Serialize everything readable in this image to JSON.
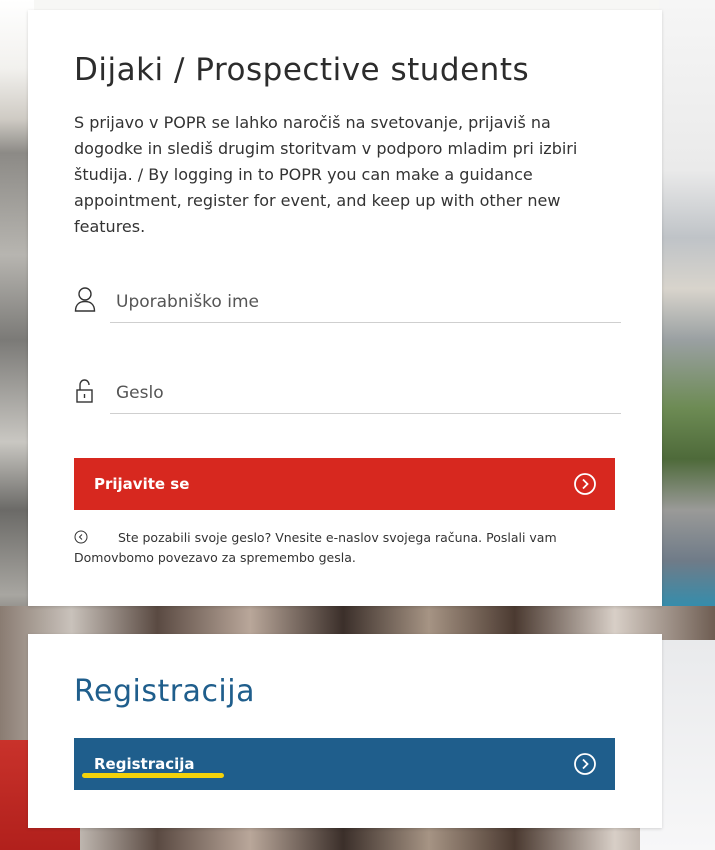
{
  "login": {
    "title": "Dijaki / Prospective students",
    "description": "S prijavo v POPR se lahko naročiš na svetovanje, prijaviš na dogodke in slediš drugim storitvam v podporo mladim pri izbiri študija. / By logging in to POPR you can make a guidance appointment, register for event, and keep up with other new features.",
    "username": {
      "placeholder": "Uporabniško ime",
      "value": "",
      "icon": "user-icon"
    },
    "password": {
      "placeholder": "Geslo",
      "value": "",
      "icon": "lock-icon"
    },
    "submit_label": "Prijavite se",
    "submit_icon": "chevron-right-circle-icon",
    "forgot_text": "Ste pozabili svoje geslo? Vnesite e-naslov svojega računa. Poslali vam",
    "forgot_text_2": "Domovbomo povezavo za spremembo gesla.",
    "forgot_icon": "chevron-left-circle-icon"
  },
  "registration": {
    "title": "Registracija",
    "button_label": "Registracija",
    "button_icon": "chevron-right-circle-icon"
  },
  "colors": {
    "login_button": "#d7281f",
    "register_button": "#1f5e8c",
    "register_title": "#1f5e8c",
    "highlight_underline": "#f4d20a"
  }
}
